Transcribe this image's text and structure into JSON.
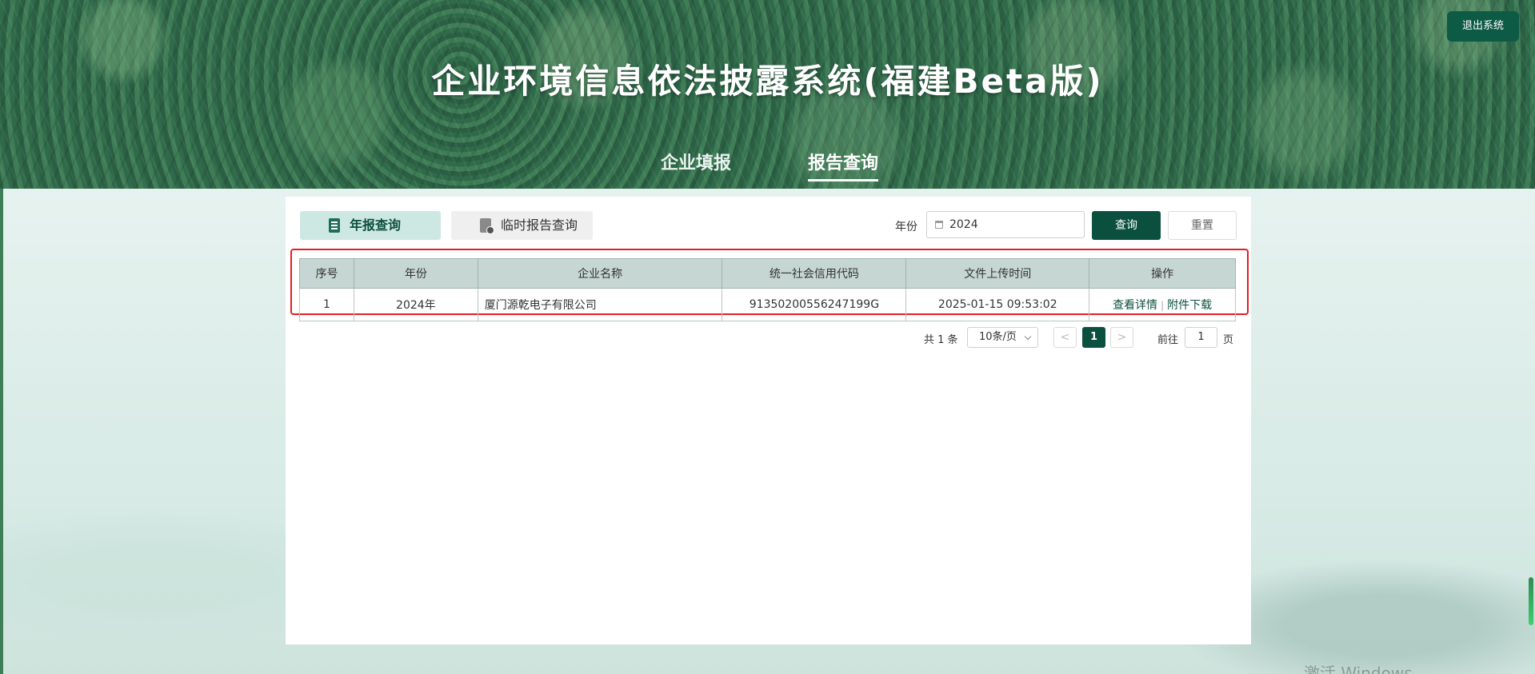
{
  "header": {
    "title": "企业环境信息依法披露系统(福建Beta版)",
    "logout_label": "退出系统",
    "nav": [
      {
        "label": "企业填报",
        "active": false
      },
      {
        "label": "报告查询",
        "active": true
      }
    ]
  },
  "tabs": [
    {
      "label": "年报查询",
      "icon": "annual-report-icon",
      "active": true
    },
    {
      "label": "临时报告查询",
      "icon": "temporary-report-icon",
      "active": false
    }
  ],
  "filter": {
    "year_label": "年份",
    "year_value": "2024",
    "query_label": "查询",
    "reset_label": "重置"
  },
  "table": {
    "columns": [
      "序号",
      "年份",
      "企业名称",
      "统一社会信用代码",
      "文件上传时间",
      "操作"
    ],
    "rows": [
      {
        "index": "1",
        "year": "2024年",
        "company": "厦门源乾电子有限公司",
        "credit_code": "91350200556247199G",
        "upload_time": "2025-01-15 09:53:02",
        "actions": [
          "查看详情",
          "附件下载"
        ]
      }
    ],
    "action_separator": "|"
  },
  "pagination": {
    "total_text": "共 1 条",
    "page_size": "10条/页",
    "prev": "<",
    "current_page": "1",
    "next": ">",
    "goto_label": "前往",
    "goto_value": "1",
    "page_unit": "页"
  },
  "watermark": "激活 Windows",
  "colors": {
    "primary": "#0b4f3e",
    "tab_active_bg": "#cde7e2",
    "table_header_bg": "#c6d6d2",
    "highlight_border": "#e31e24"
  }
}
